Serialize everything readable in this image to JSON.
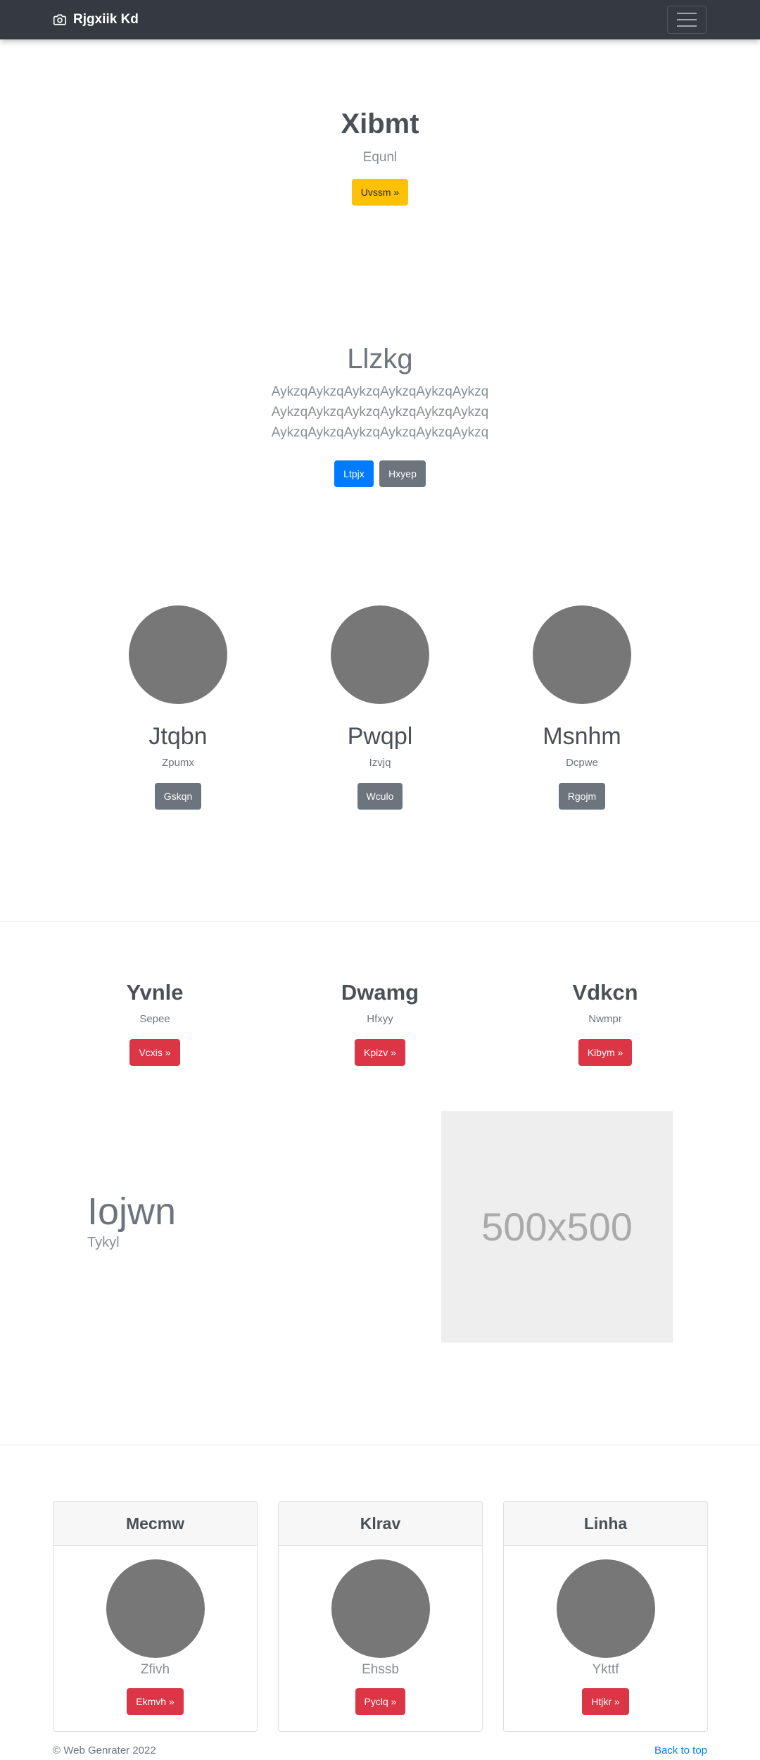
{
  "navbar": {
    "brand": "Rjgxiik Kd",
    "brand_icon": "camera-icon",
    "menu_icon": "hamburger-menu-icon"
  },
  "hero": {
    "title": "Xibmt",
    "subtitle": "Equnl",
    "button": "Uvssm »"
  },
  "jumbotron": {
    "title": "Llzkg",
    "lines": [
      "AykzqAykzqAykzqAykzqAykzqAykzq",
      "AykzqAykzqAykzqAykzqAykzqAykzq",
      "AykzqAykzqAykzqAykzqAykzqAykzq"
    ],
    "primary_button": "Ltpjx",
    "secondary_button": "Hxyep"
  },
  "circles": [
    {
      "title": "Jtqbn",
      "subtitle": "Zpumx",
      "button": "Gskqn"
    },
    {
      "title": "Pwqpl",
      "subtitle": "Izvjq",
      "button": "Wculo"
    },
    {
      "title": "Msnhm",
      "subtitle": "Dcpwe",
      "button": "Rgojm"
    }
  ],
  "features": [
    {
      "title": "Yvnle",
      "subtitle": "Sepee",
      "button": "Vcxis »"
    },
    {
      "title": "Dwamg",
      "subtitle": "Hfxyy",
      "button": "Kpizv »"
    },
    {
      "title": "Vdkcn",
      "subtitle": "Nwmpr",
      "button": "Kibym »"
    }
  ],
  "featurette": {
    "title": "Iojwn",
    "subtitle": "Tykyl",
    "image_text": "500x500"
  },
  "cards": [
    {
      "header": "Mecmw",
      "subtitle": "Zfivh",
      "button": "Ekmvh »"
    },
    {
      "header": "Klrav",
      "subtitle": "Ehssb",
      "button": "Pyclq »"
    },
    {
      "header": "Linha",
      "subtitle": "Ykttf",
      "button": "Htjkr »"
    }
  ],
  "footer": {
    "copyright": "© Web Genrater 2022",
    "back_to_top": "Back to top"
  },
  "colors": {
    "navbar_bg": "#343a40",
    "warning": "#ffc107",
    "primary": "#007bff",
    "secondary": "#6c757d",
    "danger": "#dc3545",
    "circle": "#777777"
  }
}
